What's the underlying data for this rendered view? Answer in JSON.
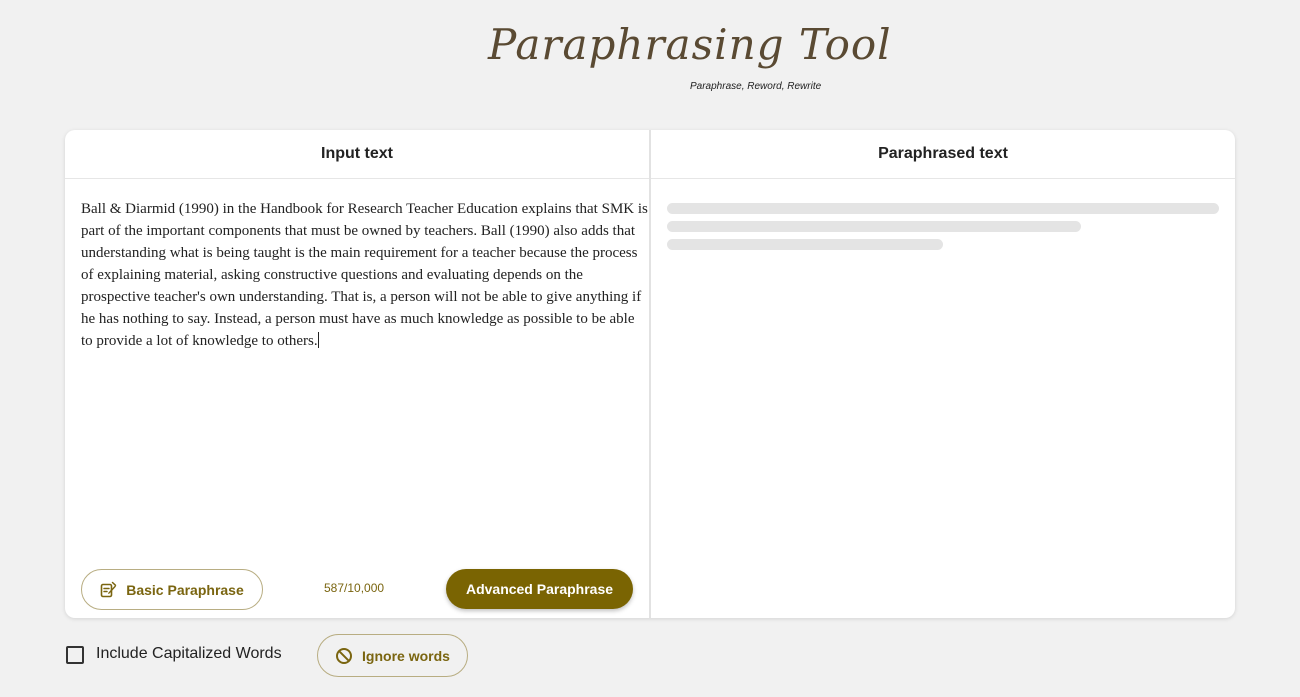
{
  "logo": {
    "title": "Paraphrasing Tool",
    "tagline": "Paraphrase, Reword, Rewrite"
  },
  "input_panel": {
    "header": "Input text",
    "text": "Ball & Diarmid (1990) in the Handbook for Research Teacher Education explains that SMK is part of the important components that must be owned by teachers. Ball (1990) also adds that understanding what is being taught is the main requirement for a teacher because the process of explaining material, asking constructive questions and evaluating depends on the prospective teacher's own understanding. That is, a person will not be able to give anything if he has nothing to say. Instead, a person must have as much knowledge as possible to be able to provide a lot of knowledge to others.",
    "char_count": "587/10,000",
    "basic_button": "Basic Paraphrase",
    "advanced_button": "Advanced Paraphrase"
  },
  "output_panel": {
    "header": "Paraphrased text",
    "state": "loading"
  },
  "options": {
    "include_capitalized_label": "Include Capitalized Words",
    "include_capitalized_checked": false,
    "ignore_words_button": "Ignore words"
  },
  "colors": {
    "accent": "#7a6402",
    "accent_text": "#7a6510",
    "background": "#f1f1f1",
    "skeleton": "#e4e4e4"
  },
  "icons": {
    "basic_button": "paraphrase-pen-icon",
    "ignore_button": "ban-icon"
  }
}
